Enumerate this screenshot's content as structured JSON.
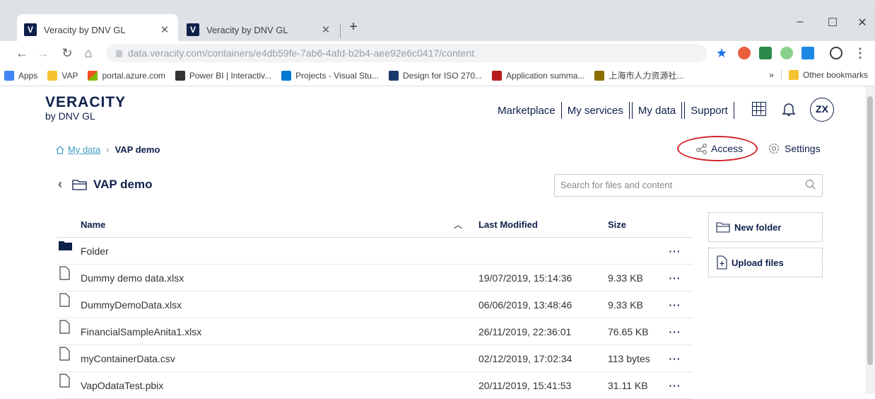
{
  "browser": {
    "tabs": [
      {
        "title": "Veracity by DNV GL",
        "favicon": "V",
        "active": true
      },
      {
        "title": "Veracity by DNV GL",
        "favicon": "V",
        "active": false
      }
    ],
    "url": "data.veracity.com/containers/e4db59fe-7ab6-4afd-b2b4-aee92e6c0417/content",
    "bookmarks": [
      {
        "label": "Apps",
        "color": "#4285f4"
      },
      {
        "label": "VAP",
        "color": "#f4c430"
      },
      {
        "label": "portal.azure.com",
        "color": "#0078d4"
      },
      {
        "label": "Power BI | Interactiv...",
        "color": "#333333"
      },
      {
        "label": "Projects - Visual Stu...",
        "color": "#0078d4"
      },
      {
        "label": "Design for ISO 270...",
        "color": "#1a3a6b"
      },
      {
        "label": "Application summa...",
        "color": "#b71c1c"
      },
      {
        "label": "上海市人力资源社...",
        "color": "#8d6e00"
      }
    ],
    "bookmarks_overflow": "»",
    "other_bookmarks": "Other bookmarks"
  },
  "header": {
    "logo_main": "VERACITY",
    "logo_sub": "by DNV GL",
    "nav": [
      "Marketplace",
      "My services",
      "My data",
      "Support"
    ],
    "avatar": "ZX"
  },
  "breadcrumb": {
    "root": "My data",
    "current": "VAP demo"
  },
  "actions": {
    "access": "Access",
    "settings": "Settings"
  },
  "folder": {
    "title": "VAP demo"
  },
  "search": {
    "placeholder": "Search for files and content"
  },
  "table": {
    "columns": {
      "name": "Name",
      "modified": "Last Modified",
      "size": "Size"
    },
    "rows": [
      {
        "name": "Folder",
        "modified": "",
        "size": "",
        "type": "folder"
      },
      {
        "name": "Dummy demo data.xlsx",
        "modified": "19/07/2019, 15:14:36",
        "size": "9.33 KB",
        "type": "file"
      },
      {
        "name": "DummyDemoData.xlsx",
        "modified": "06/06/2019, 13:48:46",
        "size": "9.33 KB",
        "type": "file"
      },
      {
        "name": "FinancialSampleAnita1.xlsx",
        "modified": "26/11/2019, 22:36:01",
        "size": "76.65 KB",
        "type": "file"
      },
      {
        "name": "myContainerData.csv",
        "modified": "02/12/2019, 17:02:34",
        "size": "113 bytes",
        "type": "file"
      },
      {
        "name": "VapOdataTest.pbix",
        "modified": "20/11/2019, 15:41:53",
        "size": "31.11 KB",
        "type": "file"
      }
    ],
    "row_menu": "···"
  },
  "side_actions": {
    "new_folder": "New folder",
    "upload": "Upload files"
  },
  "colors": {
    "brand": "#0f204b",
    "link": "#3f9cc6",
    "highlight": "#d2242a"
  }
}
